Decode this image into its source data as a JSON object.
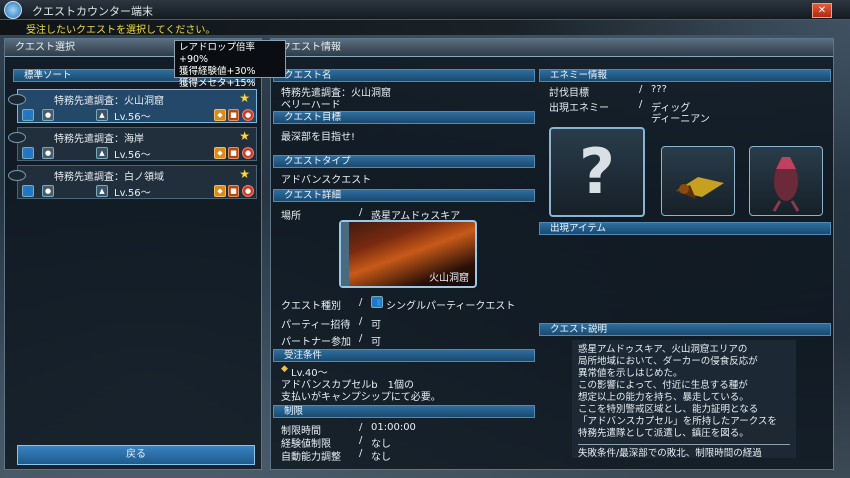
{
  "window": {
    "title": "クエストカウンター端末",
    "close_label": "✕"
  },
  "instruction": "受注したいクエストを選択してください。",
  "left": {
    "header": "クエスト選択",
    "sort_label": "標準ソート",
    "quests": [
      {
        "name": "特務先遣調査：火山洞窟",
        "level": "Lv.56〜",
        "selected": true
      },
      {
        "name": "特務先遣調査：海岸",
        "level": "Lv.56〜",
        "selected": false
      },
      {
        "name": "特務先遣調査：白ノ領域",
        "level": "Lv.56〜",
        "selected": false
      }
    ],
    "back_label": "戻る"
  },
  "tooltip": {
    "line1": "レアドロップ倍率+90%",
    "line2": "獲得経験値+30%",
    "line3": "獲得メセタ+15%"
  },
  "right": {
    "header": "クエスト情報",
    "quest_name_label": "クエスト名",
    "quest_name": "特務先遣調査：火山洞窟",
    "difficulty": "ベリーハード",
    "goal_label": "クエスト目標",
    "goal": "最深部を目指せ!",
    "type_label": "クエストタイプ",
    "type": "アドバンスクエスト",
    "detail_label": "クエスト詳細",
    "place_label": "場所",
    "place": "惑星アムドゥスキア",
    "area_name": "火山洞窟",
    "kind_label": "クエスト種別",
    "kind": "シングルパーティークエスト",
    "party_invite_label": "パーティー招待",
    "party_invite": "可",
    "partner_label": "パートナー参加",
    "partner": "可",
    "conditions_label": "受注条件",
    "cond_level": "Lv.40〜",
    "cond_line2": "アドバンスカプセルb　1個の",
    "cond_line3": "支払いがキャンプシップにて必要。",
    "limit_label": "制限",
    "time_limit_label": "制限時間",
    "time_limit": "01:00:00",
    "exp_limit_label": "経験値制限",
    "exp_limit": "なし",
    "auto_label": "自動能力調整",
    "auto": "なし",
    "enemy_header": "エネミー情報",
    "target_label": "討伐目標",
    "target": "???",
    "appear_label": "出現エネミー",
    "enemy1": "ディッグ",
    "enemy2": "ディーニアン",
    "items_header": "出現アイテム",
    "desc_header": "クエスト説明",
    "desc_lines": [
      "惑星アムドゥスキア、火山洞窟エリアの",
      "局所地域において、ダーカーの侵食反応が",
      "異常値を示しはじめた。",
      "この影響によって、付近に生息する種が",
      "想定以上の能力を持ち、暴走している。",
      "ここを特別警戒区域とし、能力証明となる",
      "「アドバンスカプセル」を所持したアークスを",
      "特務先遣隊として派遣し、鎮圧を図る。"
    ],
    "desc_fail": "失敗条件/最深部での敗北、制限時間の経過"
  },
  "colors": {
    "accent": "#2e6e9e",
    "instruction": "#f0dc3c",
    "star": "#ffd43c"
  }
}
